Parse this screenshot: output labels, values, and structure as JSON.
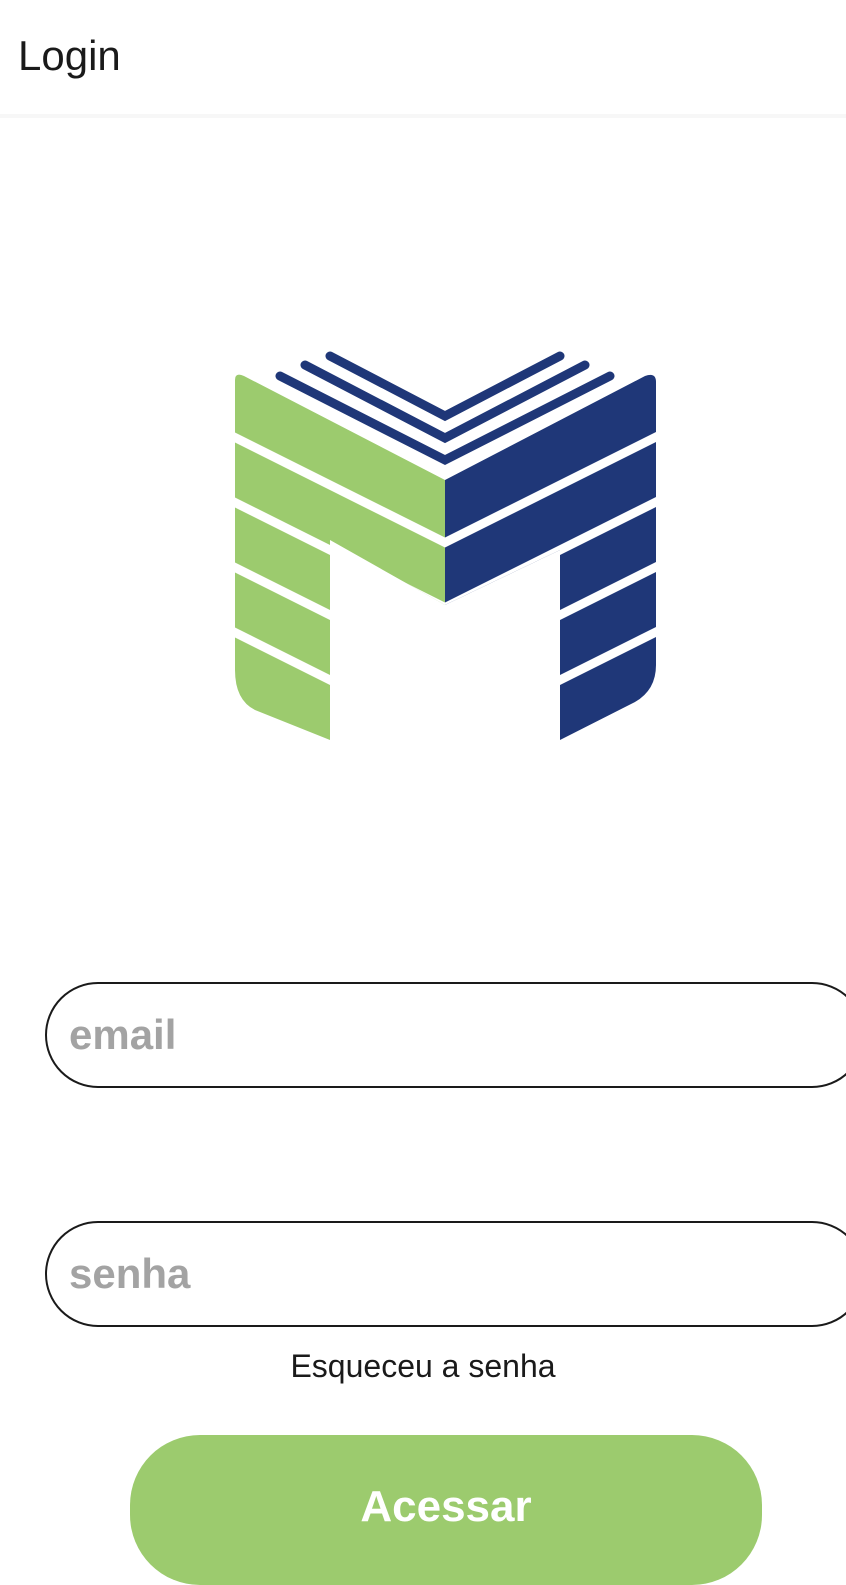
{
  "header": {
    "title": "Login"
  },
  "logo": {
    "name": "brand-m-logo",
    "colors": {
      "green": "#9ccb6e",
      "navy": "#1f3778",
      "stripe": "#ffffff"
    }
  },
  "form": {
    "email_placeholder": "email",
    "email_value": "",
    "password_placeholder": "senha",
    "password_value": "",
    "forgot_label": "Esqueceu a senha",
    "submit_label": "Acessar"
  },
  "theme": {
    "accent": "#9ccb6e",
    "text": "#1a1a1a",
    "placeholder": "#a3a3a3"
  }
}
